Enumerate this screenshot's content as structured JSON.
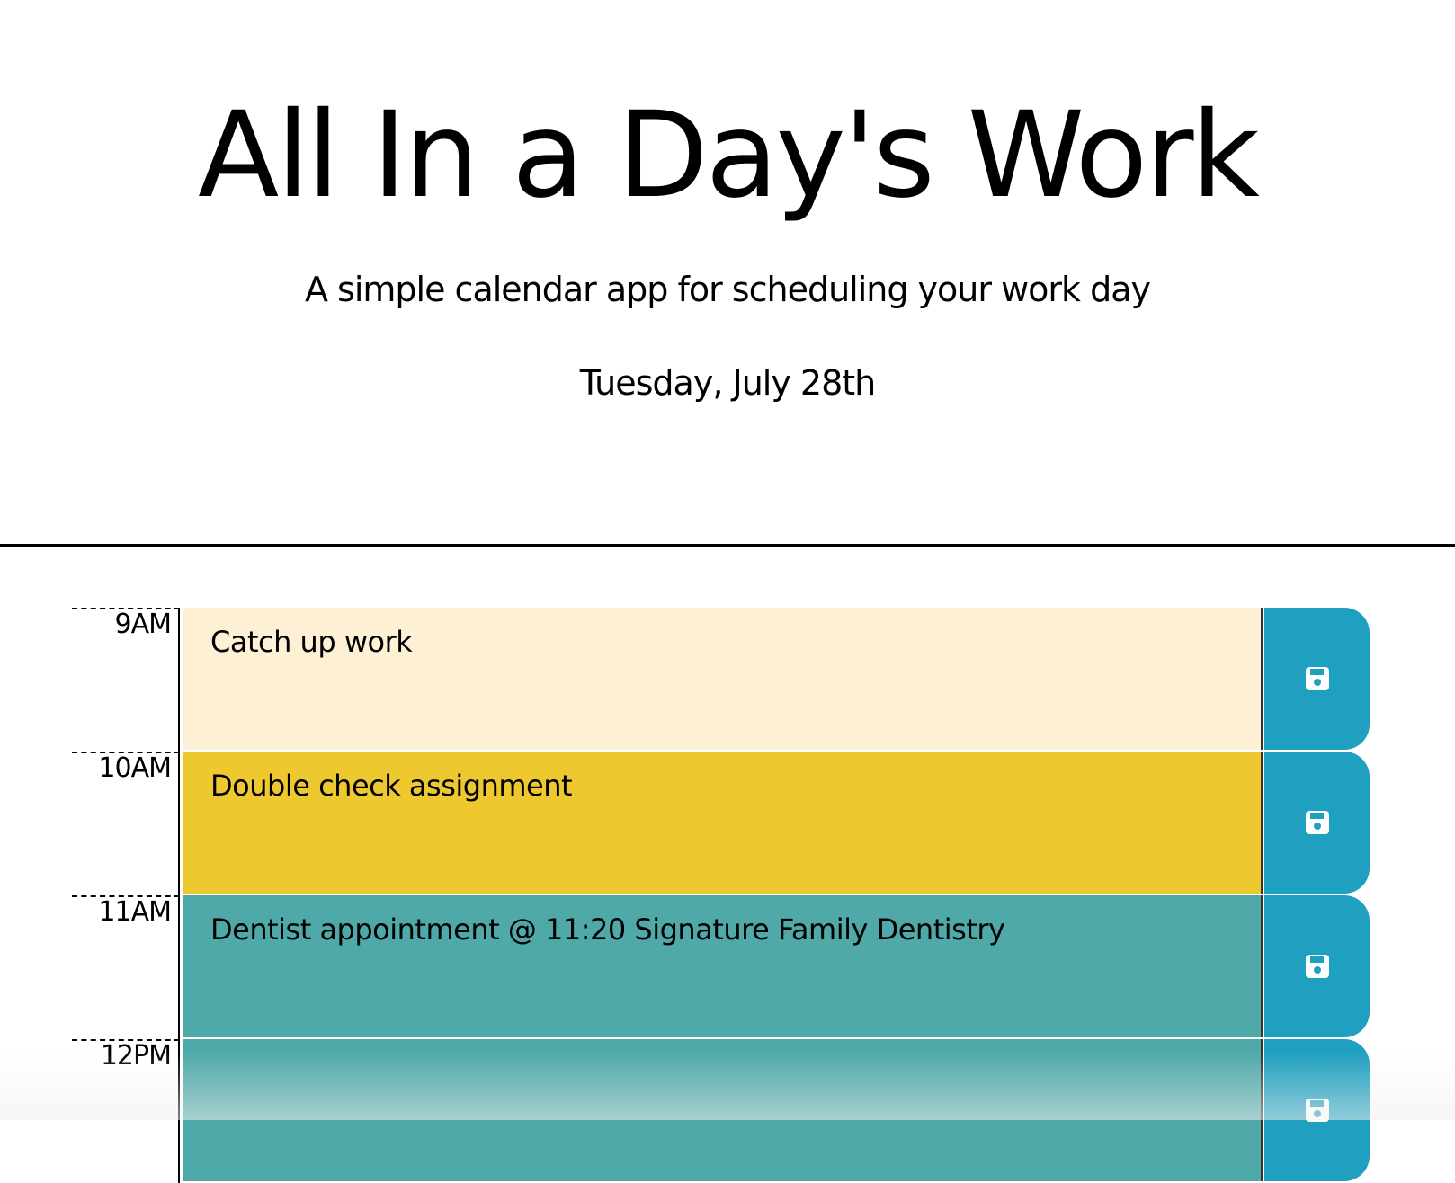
{
  "header": {
    "title": "All In a Day's Work",
    "subtitle": "A simple calendar app for scheduling your work day",
    "current_day": "Tuesday, July 28th"
  },
  "colors": {
    "past": "#fdf0d5",
    "present": "#eec82f",
    "future": "#4ea9a8",
    "save_button": "#1fa0c0"
  },
  "timeblocks": [
    {
      "hour": "9AM",
      "text": "Catch up work",
      "state": "past",
      "icon": "save-icon"
    },
    {
      "hour": "10AM",
      "text": "Double check assignment",
      "state": "present",
      "icon": "save-icon"
    },
    {
      "hour": "11AM",
      "text": "Dentist appointment @ 11:20 Signature Family Dentistry",
      "state": "future",
      "icon": "save-icon"
    },
    {
      "hour": "12PM",
      "text": "",
      "state": "future",
      "icon": "save-icon"
    }
  ]
}
